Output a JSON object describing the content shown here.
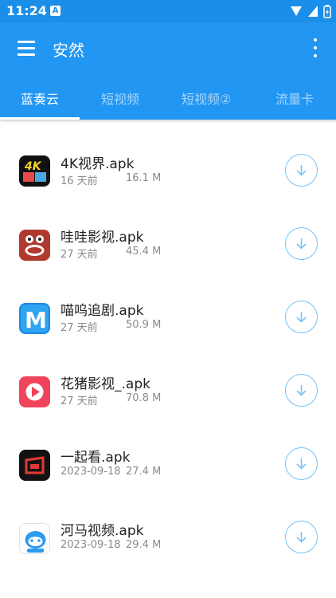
{
  "status": {
    "time": "11:24",
    "notif_letter": "A"
  },
  "app_bar": {
    "title": "安然"
  },
  "tabs": [
    {
      "label": "蓝奏云",
      "active": true
    },
    {
      "label": "短视频",
      "active": false
    },
    {
      "label": "短视频②",
      "active": false
    },
    {
      "label": "流量卡",
      "active": false
    }
  ],
  "files": [
    {
      "name": "4K视界.apk",
      "date": "16 天前",
      "size": "16.1 M",
      "icon": "4k-icon"
    },
    {
      "name": "哇哇影视.apk",
      "date": "27 天前",
      "size": "45.4 M",
      "icon": "frog-icon"
    },
    {
      "name": "喵呜追剧.apk",
      "date": "27 天前",
      "size": "50.9 M",
      "icon": "m-icon"
    },
    {
      "name": "花猪影视_.apk",
      "date": "27 天前",
      "size": "70.8 M",
      "icon": "play-icon"
    },
    {
      "name": "一起看.apk",
      "date": "2023-09-18",
      "size": "27.4 M",
      "icon": "tv-icon"
    },
    {
      "name": "河马视频.apk",
      "date": "2023-09-18",
      "size": "29.4 M",
      "icon": "hippo-icon"
    }
  ],
  "colors": {
    "primary": "#2196f3",
    "status": "#1a8ee8",
    "download_ring": "#74c3f5"
  }
}
